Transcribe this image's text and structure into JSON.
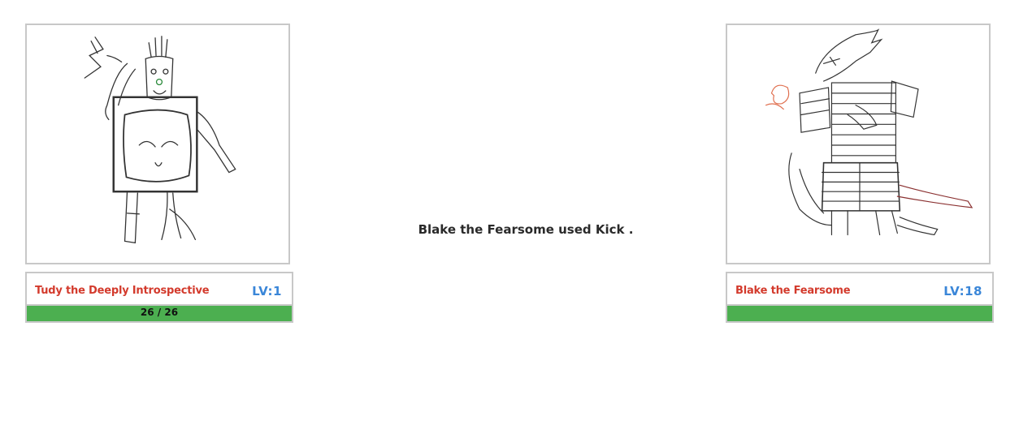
{
  "player": {
    "name": "Tudy the Deeply Introspective",
    "level": "LV:1",
    "hp_text": "26 / 26",
    "hp_fraction": 1.0,
    "portrait_icon": "tree-stump-creature-sketch"
  },
  "enemy": {
    "name": "Blake the Fearsome",
    "level": "LV:18",
    "hp_fraction": 1.0,
    "portrait_icon": "armored-lizard-creature-sketch"
  },
  "battle_log": {
    "message": "Blake the Fearsome used Kick ."
  },
  "colors": {
    "name": "#d33a2c",
    "level": "#3a86d8",
    "hp_fill": "#4caf50",
    "border": "#c8c8c8"
  }
}
